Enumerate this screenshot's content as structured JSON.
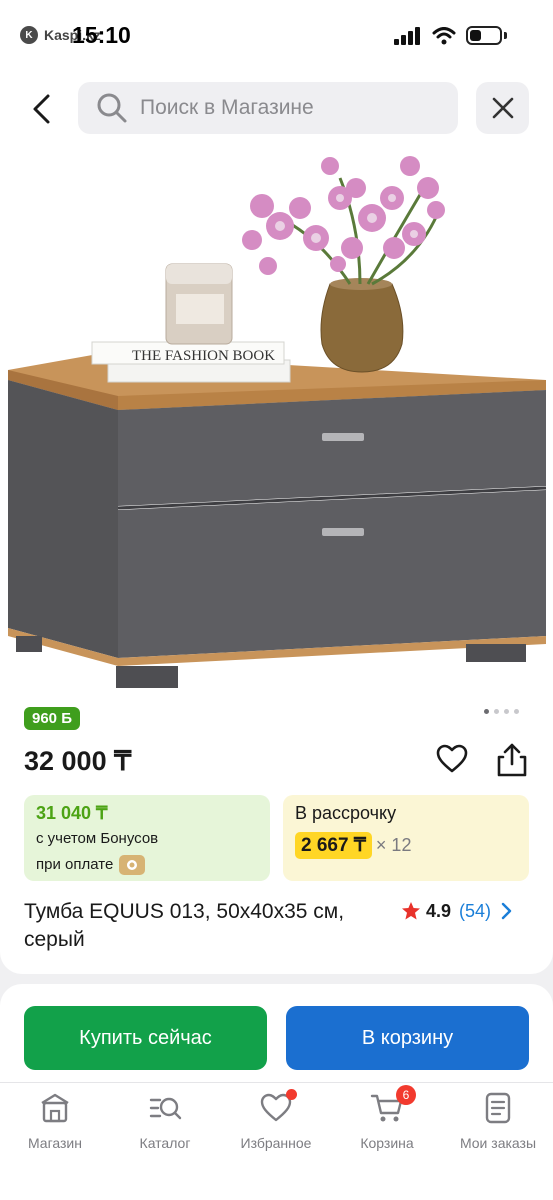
{
  "status_bar": {
    "back_app": "Kaspi.kz",
    "time": "15:10"
  },
  "search": {
    "placeholder": "Поиск в Магазине"
  },
  "product": {
    "bonus_badge": "960 Б",
    "price": "32 000 ₸",
    "bonus_price": "31 040 ₸",
    "bonus_note_line1": "с учетом Бонусов",
    "bonus_note_line2": "при оплате",
    "installment_title": "В рассрочку",
    "installment_amount": "2 667 ₸",
    "installment_months": "× 12",
    "title": "Тумба EQUUS 013, 50x40x35 см, серый",
    "rating": "4.9",
    "reviews": "(54)",
    "carousel": {
      "total": 4,
      "active": 1
    },
    "image_book_text": "THE FASHION BOOK"
  },
  "actions": {
    "buy_now": "Купить сейчас",
    "add_to_cart": "В корзину"
  },
  "tabs": [
    {
      "label": "Магазин",
      "icon": "shop-icon"
    },
    {
      "label": "Каталог",
      "icon": "catalog-icon"
    },
    {
      "label": "Избранное",
      "icon": "heart-icon",
      "dot": true
    },
    {
      "label": "Корзина",
      "icon": "cart-icon",
      "badge": "6"
    },
    {
      "label": "Мои заказы",
      "icon": "orders-icon"
    }
  ],
  "colors": {
    "green_button": "#12a14a",
    "blue_button": "#1b6fd0",
    "bonus_green": "#3f9e1d",
    "installment_yellow": "#ffd625",
    "badge_red": "#f23a2e"
  }
}
